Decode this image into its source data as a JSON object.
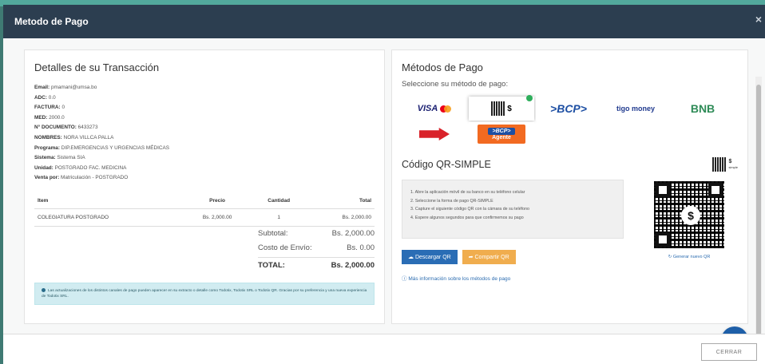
{
  "modal": {
    "title": "Metodo de Pago",
    "close_icon": "close-icon"
  },
  "transaction": {
    "heading": "Detalles de su Transacción",
    "info": [
      {
        "label": "Email:",
        "value": "pmamani@umsa.bo"
      },
      {
        "label": "ADC:",
        "value": "0.0"
      },
      {
        "label": "FACTURA:",
        "value": "0"
      },
      {
        "label": "MED:",
        "value": "2000.0"
      },
      {
        "label": "N° DOCUMENTO:",
        "value": "6433273"
      },
      {
        "label": "NOMBRES:",
        "value": "NORA VILLCA PALLA"
      },
      {
        "label": "Programa:",
        "value": "DIP.EMERGENCIAS Y URGENCIAS MÉDICAS"
      },
      {
        "label": "Sistema:",
        "value": "Sistema SIA"
      },
      {
        "label": "Unidad:",
        "value": "POSTGRADO FAC. MEDICINA"
      },
      {
        "label": "Venta por:",
        "value": "Matriculación - POSTGRADO"
      }
    ],
    "table": {
      "headers": [
        "Item",
        "Precio",
        "Cantidad",
        "Total"
      ],
      "rows": [
        {
          "item": "COLEGIATURA POSTGRADO",
          "precio": "Bs. 2,000.00",
          "cantidad": "1",
          "total": "Bs. 2,000.00"
        }
      ]
    },
    "totals": {
      "subtotal_label": "Subtotal:",
      "subtotal": "Bs. 2,000.00",
      "envio_label": "Costo de Envío:",
      "envio": "Bs. 0.00",
      "total_label": "TOTAL:",
      "total": "Bs. 2,000.00"
    },
    "alert": "Las actualizaciones de los distintos canales de pago pueden aparecer en su extracto o detalle como Todotix, Todotix SRL o Todotix QR. Gracias por su preferencia y una nueva experiencia de Todotix SRL."
  },
  "payment": {
    "heading": "Métodos de Pago",
    "subtitle": "Seleccione su método de pago:",
    "methods": [
      {
        "name": "VISA",
        "icon": "visa-mastercard-logo",
        "selected": false
      },
      {
        "name": "$",
        "icon": "qr-simple-icon",
        "selected": true
      },
      {
        "name": ">BCP>",
        "icon": "bcp-logo",
        "selected": false
      },
      {
        "name": "tigo money",
        "icon": "tigo-money-logo",
        "selected": false
      },
      {
        "name": "BNB",
        "icon": "bnb-logo",
        "selected": false
      },
      {
        "name": "PAGO EXPRESS",
        "icon": "pago-express-logo",
        "selected": false
      },
      {
        "name": ">BCP>",
        "sub": "Agente",
        "icon": "bcp-agente-logo",
        "selected": false
      }
    ],
    "qr": {
      "title": "Código QR-SIMPLE",
      "badge": "$",
      "badge_sub": "simple",
      "steps": [
        "1. Abre la aplicación móvil de su banco en su teléfono celular",
        "2. Seleccione la forma de pago QR-SIMPLE",
        "3. Capture el siguiente código QR con la cámara de su teléfono",
        "4. Espere algunos segundos para que confirmemos su pago"
      ],
      "regenerate": "Generar nuevo QR",
      "download": "Descargar QR",
      "share": "Compartir QR",
      "more_info": "Más información sobre los métodos de pago"
    }
  },
  "footer": {
    "close_button": "CERRAR"
  }
}
